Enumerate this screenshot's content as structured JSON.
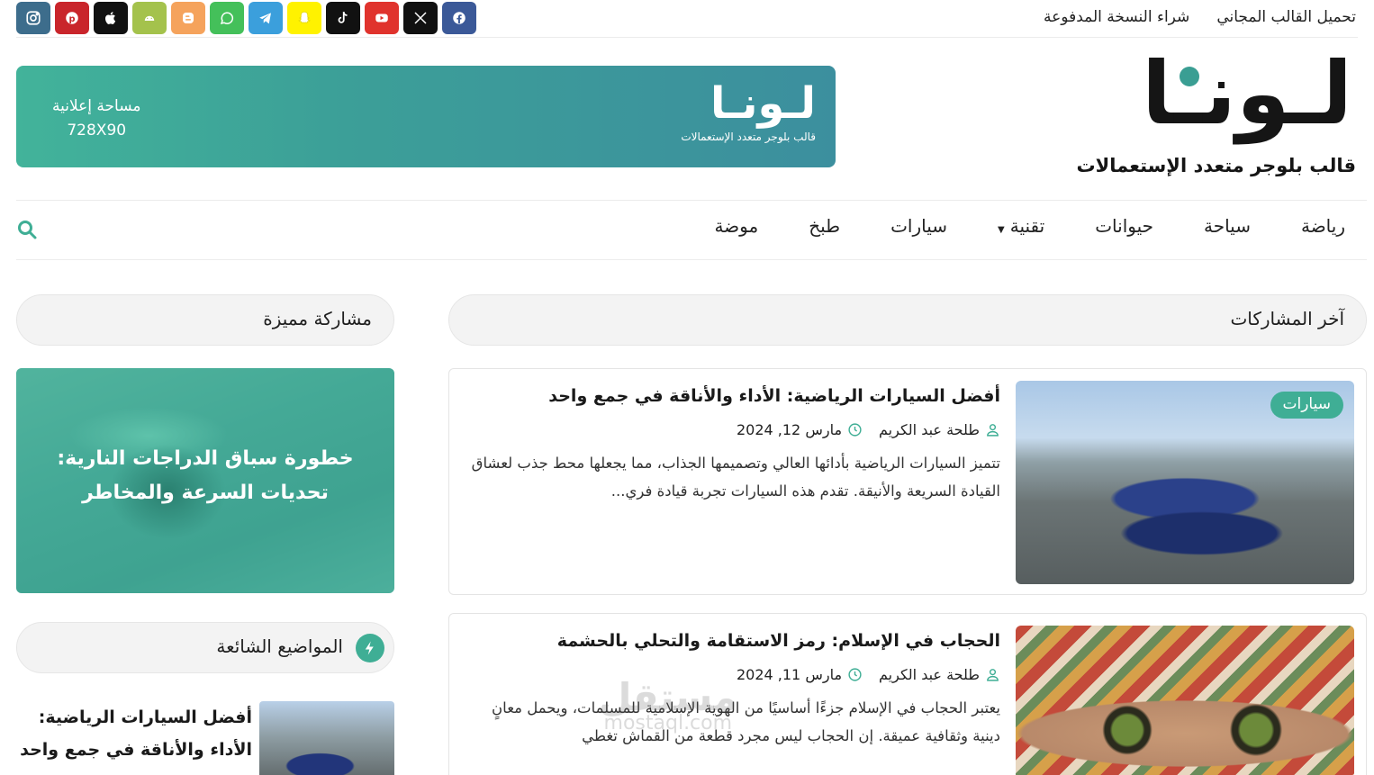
{
  "topbar": {
    "links": [
      "تحميل القالب المجاني",
      "شراء النسخة المدفوعة"
    ],
    "socials": [
      {
        "name": "facebook-icon",
        "color": "#3b5998"
      },
      {
        "name": "x-icon",
        "color": "#111111"
      },
      {
        "name": "youtube-icon",
        "color": "#e0332d"
      },
      {
        "name": "tiktok-icon",
        "color": "#111111"
      },
      {
        "name": "snapchat-icon",
        "color": "#fff200"
      },
      {
        "name": "telegram-icon",
        "color": "#3b9fdc"
      },
      {
        "name": "whatsapp-icon",
        "color": "#44c05a"
      },
      {
        "name": "blogger-icon",
        "color": "#f5a35c"
      },
      {
        "name": "android-icon",
        "color": "#a4c24c"
      },
      {
        "name": "apple-icon",
        "color": "#111111"
      },
      {
        "name": "pinterest-icon",
        "color": "#c9252b"
      },
      {
        "name": "instagram-icon",
        "color": "#3d6d8c"
      }
    ]
  },
  "logo": {
    "wordmark": "لـونـا",
    "tagline": "قالب بلوجر متعدد الإستعمالات"
  },
  "ad": {
    "wordmark": "لـونـا",
    "tagline": "قالب بلوجر متعدد الإستعمالات",
    "label": "مساحة إعلانية",
    "size": "728X90"
  },
  "nav": {
    "items": [
      "رياضة",
      "سياحة",
      "حيوانات",
      "تقنية",
      "سيارات",
      "طبخ",
      "موضة"
    ]
  },
  "sections": {
    "latest": "آخر المشاركات",
    "featured": "مشاركة مميزة",
    "popular": "المواضيع الشائعة"
  },
  "posts": [
    {
      "badge": "سيارات",
      "title": "أفضل السيارات الرياضية: الأداء والأناقة في جمع واحد",
      "author": "طلحة عبد الكريم",
      "date": "مارس 12, 2024",
      "excerpt": "تتميز السيارات الرياضية بأدائها العالي وتصميمها الجذاب، مما يجعلها محط جذب لعشاق القيادة السريعة والأنيقة. تقدم هذه السيارات تجربة قيادة فري..."
    },
    {
      "title": "الحجاب في الإسلام: رمز الاستقامة والتحلي بالحشمة",
      "author": "طلحة عبد الكريم",
      "date": "مارس 11, 2024",
      "excerpt": "يعتبر الحجاب في الإسلام جزءًا أساسيًا من الهوية الإسلامية للمسلمات، ويحمل معانٍ دينية وثقافية عميقة. إن الحجاب ليس مجرد قطعة من القماش تغطي"
    }
  ],
  "featured": {
    "title": "خطورة سباق الدراجات النارية: تحديات السرعة والمخاطر"
  },
  "popular": [
    {
      "title": "أفضل السيارات الرياضية: الأداء والأناقة في جمع واحد"
    }
  ],
  "watermark": {
    "line1": "مستقل",
    "line2": "mostaql.com"
  },
  "colors": {
    "accent": "#3fae95",
    "text": "#1f1f1f"
  }
}
